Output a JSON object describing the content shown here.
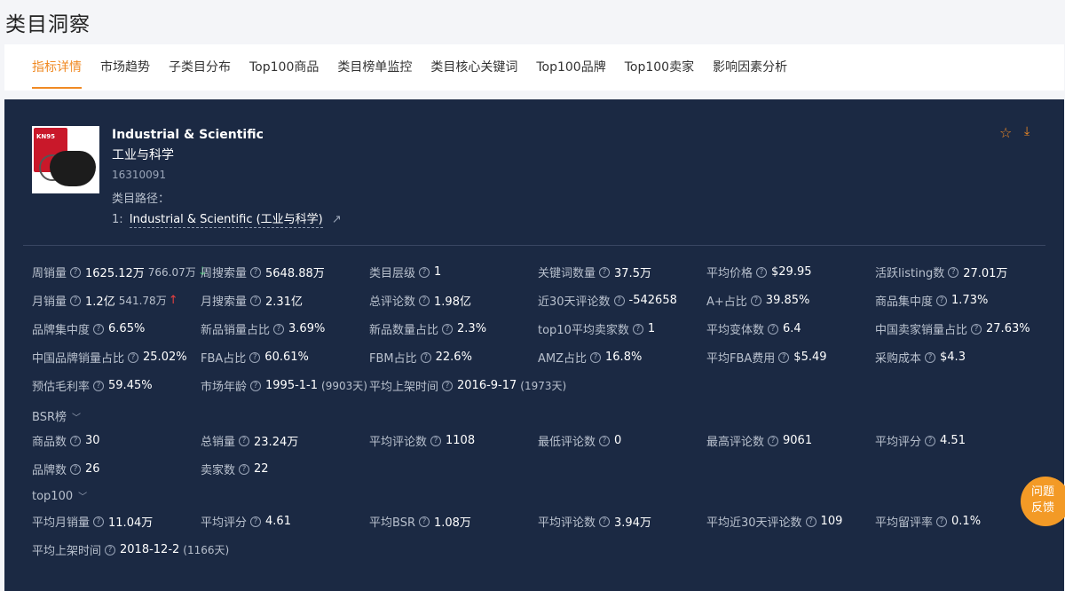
{
  "page_title": "类目洞察",
  "tabs": [
    "指标详情",
    "市场趋势",
    "子类目分布",
    "Top100商品",
    "类目榜单监控",
    "类目核心关键词",
    "Top100品牌",
    "Top100卖家",
    "影响因素分析"
  ],
  "category": {
    "name_en": "Industrial & Scientific",
    "name_cn": "工业与科学",
    "id": "16310091",
    "path_label": "类目路径：",
    "path_index": "1:",
    "path_text": "Industrial & Scientific (工业与科学)",
    "thumb_text": "KN95"
  },
  "metrics": [
    [
      {
        "label": "周销量",
        "value": "1625.12万",
        "sub": "766.07万",
        "trend": "↓"
      },
      {
        "label": "周搜索量",
        "value": "5648.88万"
      },
      {
        "label": "类目层级",
        "value": "1"
      },
      {
        "label": "关键词数量",
        "value": "37.5万"
      },
      {
        "label": "平均价格",
        "value": "$29.95"
      },
      {
        "label": "活跃listing数",
        "value": "27.01万"
      }
    ],
    [
      {
        "label": "月销量",
        "value": "1.2亿",
        "sub": "541.78万",
        "trend": "↑"
      },
      {
        "label": "月搜索量",
        "value": "2.31亿"
      },
      {
        "label": "总评论数",
        "value": "1.98亿"
      },
      {
        "label": "近30天评论数",
        "value": "-542658"
      },
      {
        "label": "A+占比",
        "value": "39.85%"
      },
      {
        "label": "商品集中度",
        "value": "1.73%"
      }
    ],
    [
      {
        "label": "品牌集中度",
        "value": "6.65%"
      },
      {
        "label": "新品销量占比",
        "value": "3.69%"
      },
      {
        "label": "新品数量占比",
        "value": "2.3%"
      },
      {
        "label": "top10平均卖家数",
        "value": "1"
      },
      {
        "label": "平均变体数",
        "value": "6.4"
      },
      {
        "label": "中国卖家销量占比",
        "value": "27.63%"
      }
    ],
    [
      {
        "label": "中国品牌销量占比",
        "value": "25.02%"
      },
      {
        "label": "FBA占比",
        "value": "60.61%"
      },
      {
        "label": "FBM占比",
        "value": "22.6%"
      },
      {
        "label": "AMZ占比",
        "value": "16.8%"
      },
      {
        "label": "平均FBA费用",
        "value": "$5.49"
      },
      {
        "label": "采购成本",
        "value": "$4.3"
      }
    ],
    [
      {
        "label": "预估毛利率",
        "value": "59.45%"
      },
      {
        "label": "市场年龄",
        "value": "1995-1-1",
        "sub": "(9903天)"
      },
      {
        "label": "平均上架时间",
        "value": "2016-9-17",
        "sub": "(1973天)"
      }
    ]
  ],
  "bsr": {
    "title": "BSR榜",
    "rows": [
      [
        {
          "label": "商品数",
          "value": "30"
        },
        {
          "label": "总销量",
          "value": "23.24万"
        },
        {
          "label": "平均评论数",
          "value": "1108"
        },
        {
          "label": "最低评论数",
          "value": "0"
        },
        {
          "label": "最高评论数",
          "value": "9061"
        },
        {
          "label": "平均评分",
          "value": "4.51"
        }
      ],
      [
        {
          "label": "品牌数",
          "value": "26"
        },
        {
          "label": "卖家数",
          "value": "22"
        }
      ]
    ]
  },
  "top100": {
    "title": "top100",
    "rows": [
      [
        {
          "label": "平均月销量",
          "value": "11.04万"
        },
        {
          "label": "平均评分",
          "value": "4.61"
        },
        {
          "label": "平均BSR",
          "value": "1.08万"
        },
        {
          "label": "平均评论数",
          "value": "3.94万"
        },
        {
          "label": "平均近30天评论数",
          "value": "109"
        },
        {
          "label": "平均留评率",
          "value": "0.1%"
        }
      ],
      [
        {
          "label": "平均上架时间",
          "value": "2018-12-2",
          "sub": "(1166天)"
        }
      ]
    ]
  },
  "feedback": {
    "line1": "问题",
    "line2": "反馈"
  },
  "colors": {
    "accent": "#f08a24",
    "panel_bg": "#1b2943",
    "up": "#e84040",
    "down": "#3cc06b"
  }
}
